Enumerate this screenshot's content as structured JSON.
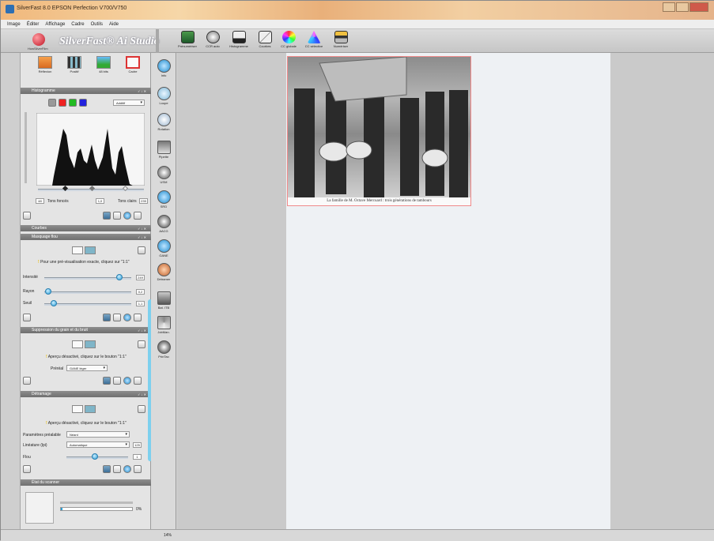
{
  "window": {
    "title": "SilverFast 8.0 EPSON Perfection V700/V750"
  },
  "menu": [
    "Image",
    "Éditer",
    "Affichage",
    "Cadre",
    "Outils",
    "Aide"
  ],
  "logo": {
    "label": "HowSilverFilm"
  },
  "brand": "SilverFast® Ai Studio",
  "toolbar": [
    {
      "icon": "prescan-icon",
      "label": "Prénumériser"
    },
    {
      "icon": "ccr-icon",
      "label": "CCR auto"
    },
    {
      "icon": "histogram-icon",
      "label": "Histogramme"
    },
    {
      "icon": "curves-icon",
      "label": "Courbes"
    },
    {
      "icon": "cc-global-icon",
      "label": "CC globale"
    },
    {
      "icon": "cc-selective-icon",
      "label": "CC sélective"
    },
    {
      "icon": "scan-icon",
      "label": "Numériser"
    }
  ],
  "panel_tools": [
    {
      "icon": "reflection-icon",
      "label": "Réflexion"
    },
    {
      "icon": "positive-icon",
      "label": "Positif"
    },
    {
      "icon": "bit-depth-icon",
      "label": "48 bits"
    },
    {
      "icon": "frame-icon",
      "label": "Cadre"
    }
  ],
  "histogram": {
    "header": "Histogramme",
    "mode_label": "Additif",
    "shadow_label": "Tons foncés",
    "highlight_label": "Tons clairs",
    "shadow_value": "48",
    "highlight_value": "235",
    "mid_value": "1,0"
  },
  "curves": {
    "header": "Courbes"
  },
  "sharpen": {
    "header": "Masquage flou",
    "hint": "Pour une pré-visualisation exacte, cliquez sur \"1:1\"",
    "intensity_label": "Intensité",
    "intensity_value": "249",
    "radius_label": "Rayon",
    "radius_value": "0,2",
    "threshold_label": "Seuil",
    "threshold_value": "1,1"
  },
  "grain": {
    "header": "Suppression du grain et du bruit",
    "hint": "Aperçu désactivé, cliquez sur le bouton \"1:1\"",
    "preset_label": "Préréal",
    "preset_value": "GANE léger"
  },
  "descreen": {
    "header": "Détramage",
    "hint": "Aperçu désactivé, cliquez sur le bouton \"1:1\"",
    "params_label": "Paramètres préalable",
    "params_value": "Néant",
    "lines_label": "Linéature (lpi)",
    "lines_value": "Automatique",
    "lines_number": "125",
    "blur_label": "Flou",
    "blur_value": "1"
  },
  "scanner_status": {
    "header": "État du scanner",
    "percent": "0%",
    "progress": 0.02
  },
  "icon_column": [
    {
      "icon": "info-icon",
      "label": "Info"
    },
    {
      "icon": "loupe-icon",
      "label": "Loupe"
    },
    {
      "icon": "rotation-icon",
      "label": "Rotation"
    },
    {
      "icon": "pipette-icon",
      "label": "Pipette"
    },
    {
      "icon": "usm-icon",
      "label": "USM"
    },
    {
      "icon": "sro-icon",
      "label": "SRD"
    },
    {
      "icon": "aacg-icon",
      "label": "AACG"
    },
    {
      "icon": "gane-icon",
      "label": "GANE"
    },
    {
      "icon": "descreen-icon",
      "label": "Détramer"
    },
    {
      "icon": "batch-icon",
      "label": "Bat. ITB"
    },
    {
      "icon": "jobmanager-icon",
      "label": "JobMan."
    },
    {
      "icon": "printtp-icon",
      "label": "PrinTao"
    }
  ],
  "preview": {
    "caption": "La famille de M. Octave Mercuard : trois générations de tambours"
  },
  "status": {
    "zoom": "14%"
  },
  "colors": {
    "accent": "#2b9fd6",
    "frame": "#f08a8a",
    "brand": "#c01424"
  }
}
